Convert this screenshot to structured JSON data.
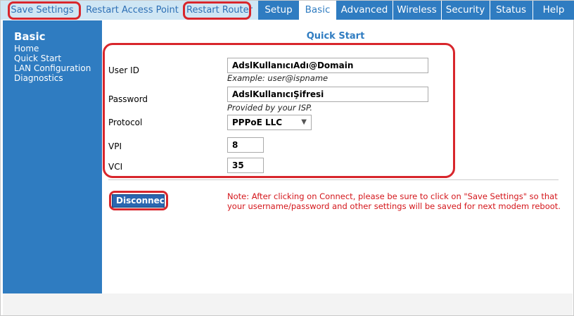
{
  "toolbar": {
    "save_settings": "Save Settings",
    "restart_access_point": "Restart Access Point",
    "restart_router": "Restart Router"
  },
  "nav": {
    "tabs": [
      {
        "label": "Setup",
        "active": false
      },
      {
        "label": "Basic",
        "active": true
      },
      {
        "label": "Advanced",
        "active": false
      },
      {
        "label": "Wireless",
        "active": false
      },
      {
        "label": "Security",
        "active": false
      },
      {
        "label": "Status",
        "active": false
      },
      {
        "label": "Help",
        "active": false
      }
    ]
  },
  "sidebar": {
    "title": "Basic",
    "items": [
      {
        "label": "Home"
      },
      {
        "label": "Quick Start"
      },
      {
        "label": "LAN Configuration"
      },
      {
        "label": "Diagnostics"
      }
    ]
  },
  "main": {
    "title": "Quick Start",
    "user_id": {
      "label": "User ID",
      "value": "AdslKullanıcıAdı@Domain",
      "hint": "Example: user@ispname"
    },
    "password": {
      "label": "Password",
      "value": "AdslKullanıcıŞifresi",
      "hint": "Provided by your ISP."
    },
    "protocol": {
      "label": "Protocol",
      "selected": "PPPoE LLC"
    },
    "vpi": {
      "label": "VPI",
      "value": "8"
    },
    "vci": {
      "label": "VCI",
      "value": "35"
    },
    "disconnect_button": "Disconnect",
    "note_line1": "Note: After clicking on Connect, please be sure to click on \"Save Settings\" so that",
    "note_line2": "your username/password and other settings will be saved for next modem reboot."
  },
  "colors": {
    "nav_blue": "#2f7cc1",
    "toolbar_light": "#cfe6f4",
    "highlight_red": "#d8262c",
    "note_red": "#d4161b"
  }
}
